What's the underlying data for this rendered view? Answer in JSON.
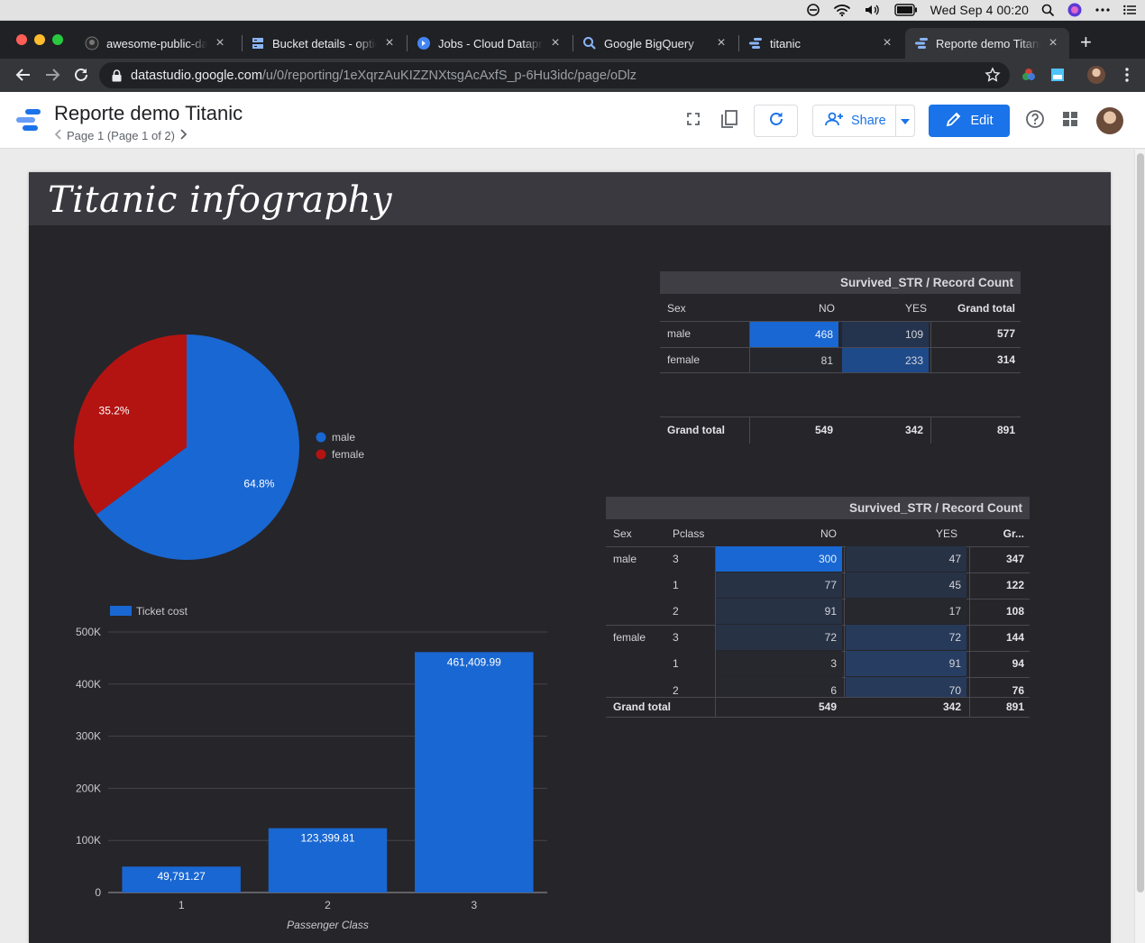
{
  "menubar": {
    "clock": "Wed Sep 4  00:20"
  },
  "browser": {
    "tabs": [
      {
        "label": "awesome-public-datasets",
        "icon": "github-icon"
      },
      {
        "label": "Bucket details - optional",
        "icon": "storage-icon"
      },
      {
        "label": "Jobs - Cloud Dataprep",
        "icon": "dataprep-icon"
      },
      {
        "label": "Google BigQuery",
        "icon": "search-icon"
      },
      {
        "label": "titanic",
        "icon": "datastudio-icon"
      },
      {
        "label": "Reporte demo Titanic",
        "icon": "datastudio-icon"
      }
    ],
    "url_host": "datastudio.google.com",
    "url_path": "/u/0/reporting/1eXqrzAuKIZZNXtsgAcAxfS_p-6Hu3idc/page/oDlz"
  },
  "header": {
    "report_title": "Reporte demo Titanic",
    "page_nav": "Page 1 (Page 1 of 2)",
    "share_label": "Share",
    "edit_label": "Edit"
  },
  "report": {
    "title": "Titanic infography"
  },
  "colors": {
    "male": "#1967d2",
    "female": "#b31412",
    "bar": "#1967d2",
    "report_bg": "#26252a",
    "banner_bg": "#3a3940"
  },
  "pivot1": {
    "header": "Survived_STR / Record Count",
    "col_sex": "Sex",
    "col_no": "NO",
    "col_yes": "YES",
    "col_total": "Grand total",
    "rows": [
      {
        "sex": "male",
        "no": "468",
        "yes": "109",
        "total": "577"
      },
      {
        "sex": "female",
        "no": "81",
        "yes": "233",
        "total": "314"
      }
    ],
    "grand_label": "Grand total",
    "grand_no": "549",
    "grand_yes": "342",
    "grand_total": "891"
  },
  "pivot2": {
    "header": "Survived_STR / Record Count",
    "col_sex": "Sex",
    "col_pclass": "Pclass",
    "col_no": "NO",
    "col_yes": "YES",
    "col_total": "Gr...",
    "groups": [
      {
        "sex": "male",
        "rows": [
          {
            "pclass": "3",
            "no": "300",
            "yes": "47",
            "total": "347"
          },
          {
            "pclass": "1",
            "no": "77",
            "yes": "45",
            "total": "122"
          },
          {
            "pclass": "2",
            "no": "91",
            "yes": "17",
            "total": "108"
          }
        ]
      },
      {
        "sex": "female",
        "rows": [
          {
            "pclass": "3",
            "no": "72",
            "yes": "72",
            "total": "144"
          },
          {
            "pclass": "1",
            "no": "3",
            "yes": "91",
            "total": "94"
          },
          {
            "pclass": "2",
            "no": "6",
            "yes": "70",
            "total": "76"
          }
        ]
      }
    ],
    "grand_label": "Grand total",
    "grand_no": "549",
    "grand_yes": "342",
    "grand_total": "891"
  },
  "chart_data": [
    {
      "type": "pie",
      "categories": [
        "male",
        "female"
      ],
      "values": [
        64.8,
        35.2
      ],
      "labels": [
        "64.8%",
        "35.2%"
      ],
      "legend": "right"
    },
    {
      "type": "bar",
      "categories": [
        "1",
        "2",
        "3"
      ],
      "values": [
        49791.27,
        123399.81,
        461409.99
      ],
      "labels": [
        "49,791.27",
        "123,399.81",
        "461,409.99"
      ],
      "series_name": "Ticket cost",
      "xlabel": "Passenger Class",
      "ylabel": "",
      "ylim": [
        0,
        500000
      ],
      "yticks": [
        0,
        100000,
        200000,
        300000,
        400000,
        500000
      ],
      "ytick_labels": [
        "0",
        "100K",
        "200K",
        "300K",
        "400K",
        "500K"
      ],
      "grid": true,
      "legend": "top-left"
    }
  ]
}
